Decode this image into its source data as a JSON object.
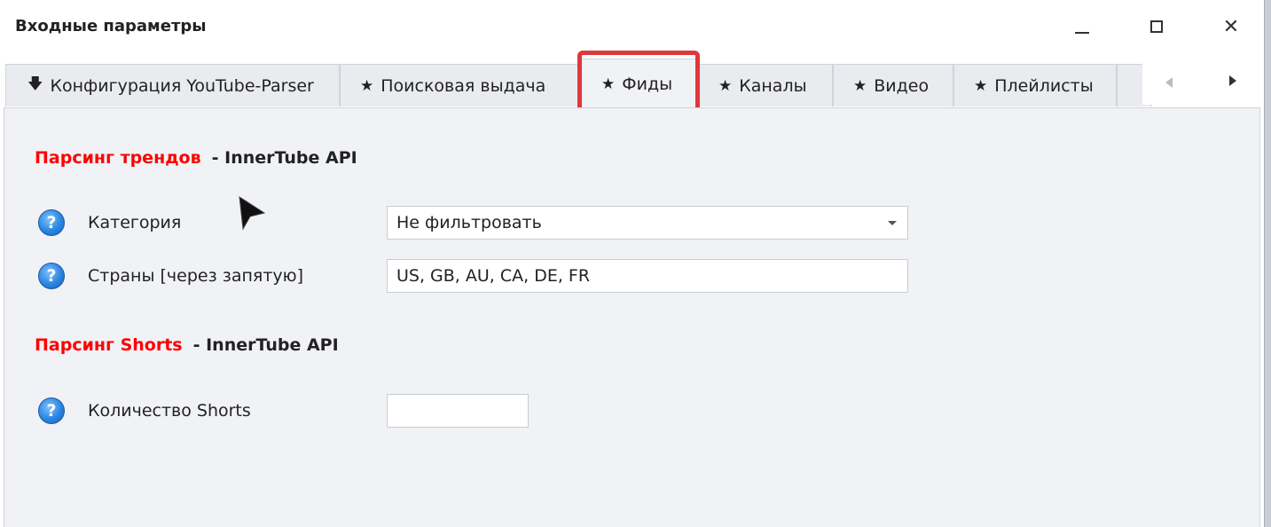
{
  "window": {
    "title": "Входные параметры",
    "controls": [
      "minimize",
      "maximize",
      "close"
    ],
    "close_glyph": "✕"
  },
  "tabs": [
    {
      "icon": "download-arrow-icon",
      "glyph": "🡇",
      "label": "Конфигурация YouTube-Parser",
      "active": false
    },
    {
      "icon": "star-icon",
      "glyph": "★",
      "label": "Поисковая выдача",
      "active": false
    },
    {
      "icon": "star-icon",
      "glyph": "★",
      "label": "Фиды",
      "active": true
    },
    {
      "icon": "star-icon",
      "glyph": "★",
      "label": "Каналы",
      "active": false
    },
    {
      "icon": "star-icon",
      "glyph": "★",
      "label": "Видео",
      "active": false
    },
    {
      "icon": "star-icon",
      "glyph": "★",
      "label": "Плейлисты",
      "active": false
    }
  ],
  "highlight_color": "#e0373a",
  "sections": {
    "trends": {
      "title_red": "Парсинг трендов",
      "title_black": "- InnerTube API",
      "fields": {
        "category": {
          "label": "Категория",
          "value": "Не фильтровать"
        },
        "countries": {
          "label": "Страны [через запятую]",
          "value": "US, GB, AU, CA, DE, FR"
        }
      }
    },
    "shorts": {
      "title_red": "Парсинг Shorts",
      "title_black": "- InnerTube API",
      "fields": {
        "count": {
          "label": "Количество Shorts",
          "value": ""
        }
      }
    }
  },
  "help_glyph": "?",
  "colors": {
    "heading_red": "#ff0000",
    "panel_bg": "#f1f2f6",
    "help_icon_blue": "#2a86e0"
  }
}
